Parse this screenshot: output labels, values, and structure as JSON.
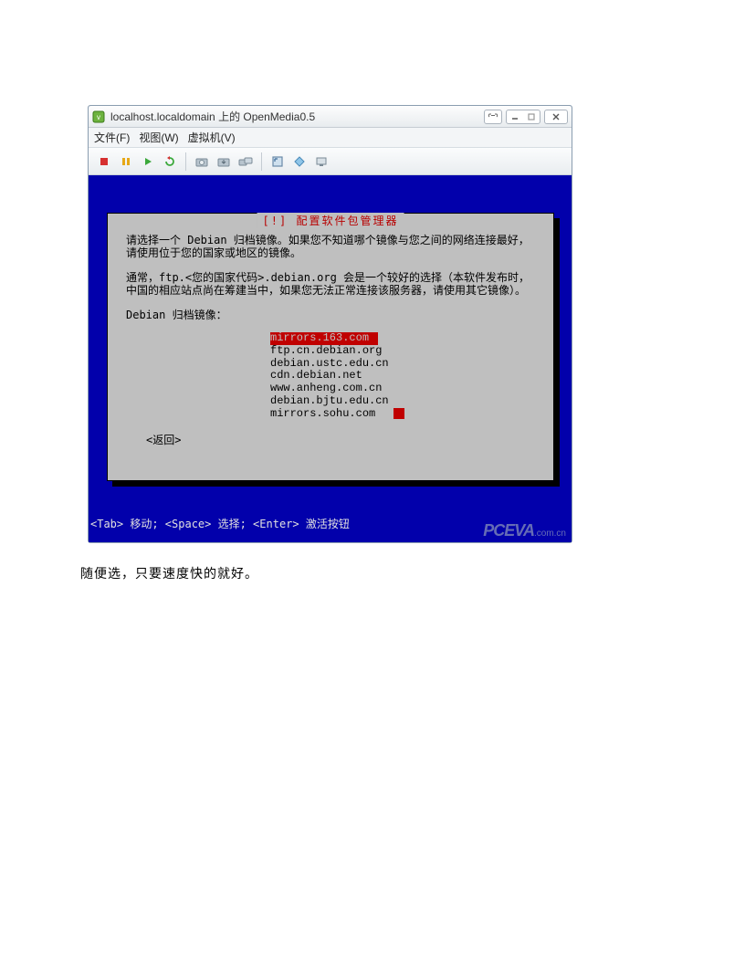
{
  "window": {
    "title": "localhost.localdomain 上的 OpenMedia0.5"
  },
  "menubar": {
    "file": "文件(F)",
    "view": "视图(W)",
    "vm": "虚拟机(V)"
  },
  "dialog": {
    "title": "[!] 配置软件包管理器",
    "para1": "请选择一个 Debian 归档镜像。如果您不知道哪个镜像与您之间的网络连接最好，请使用位于您的国家或地区的镜像。",
    "para2": "通常，ftp.<您的国家代码>.debian.org 会是一个较好的选择（本软件发布时，中国的相应站点尚在筹建当中，如果您无法正常连接该服务器，请使用其它镜像）。",
    "label": "Debian 归档镜像：",
    "mirrors": {
      "m0": "mirrors.163.com",
      "m1": "ftp.cn.debian.org",
      "m2": "debian.ustc.edu.cn",
      "m3": "cdn.debian.net",
      "m4": "www.anheng.com.cn",
      "m5": "debian.bjtu.edu.cn",
      "m6": "mirrors.sohu.com"
    },
    "back": "<返回>"
  },
  "footer": "<Tab> 移动;  <Space> 选择;  <Enter> 激活按钮",
  "watermark": {
    "main": "PCEVA",
    "suffix": ".com.cn"
  },
  "caption": "随便选，只要速度快的就好。"
}
